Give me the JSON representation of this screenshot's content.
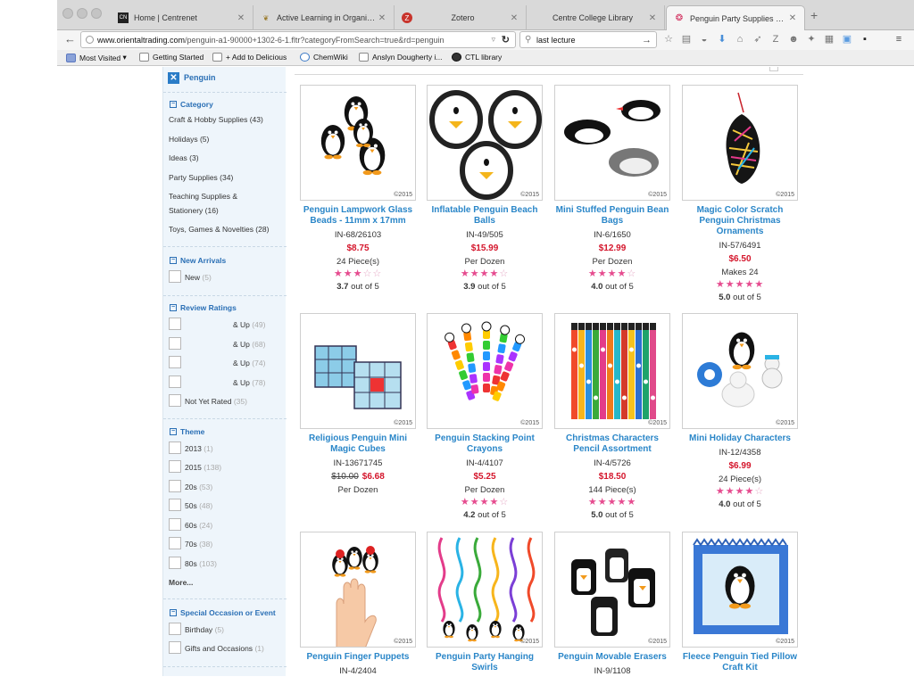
{
  "browser": {
    "tabs": [
      {
        "title": "Home | Centrenet",
        "favicon": "CN"
      },
      {
        "title": "Active Learning in Organic ...",
        "favicon": "leaf"
      },
      {
        "title": "Zotero",
        "favicon": "Z"
      },
      {
        "title": "Centre College Library",
        "favicon": ""
      },
      {
        "title": "Penguin Party Supplies & D...",
        "favicon": "swirl"
      }
    ],
    "url_host": "www.orientaltrading.com",
    "url_path": "/penguin-a1-90000+1302-6-1.fltr?categoryFromSearch=true&rd=penguin",
    "search_value": "last lecture",
    "bookmarks": [
      "Most Visited",
      "Getting Started",
      "+ Add to Delicious",
      "ChemWiki",
      "Anslyn Dougherty i...",
      "CTL library"
    ]
  },
  "sidebar": {
    "filter_tag": "Penguin",
    "category_title": "Category",
    "categories": [
      {
        "label": "Craft & Hobby Supplies (43)"
      },
      {
        "label": "Holidays (5)"
      },
      {
        "label": "Ideas (3)"
      },
      {
        "label": "Party Supplies (34)"
      },
      {
        "label": "Teaching Supplies &"
      },
      {
        "label": "Stationery (16)"
      },
      {
        "label": "Toys, Games & Novelties (28)"
      }
    ],
    "new_arrivals_title": "New Arrivals",
    "new_item": {
      "label": "New",
      "count": "(5)"
    },
    "review_title": "Review Ratings",
    "review_items": [
      {
        "label": "& Up",
        "count": "(49)"
      },
      {
        "label": "& Up",
        "count": "(68)"
      },
      {
        "label": "& Up",
        "count": "(74)"
      },
      {
        "label": "& Up",
        "count": "(78)"
      }
    ],
    "not_rated": {
      "label": "Not Yet Rated",
      "count": "(35)"
    },
    "theme_title": "Theme",
    "theme_items": [
      {
        "label": "2013",
        "count": "(1)"
      },
      {
        "label": "2015",
        "count": "(138)"
      },
      {
        "label": "20s",
        "count": "(53)"
      },
      {
        "label": "50s",
        "count": "(48)"
      },
      {
        "label": "60s",
        "count": "(24)"
      },
      {
        "label": "70s",
        "count": "(38)"
      },
      {
        "label": "80s",
        "count": "(103)"
      }
    ],
    "more_label": "More...",
    "occasion_title": "Special Occasion or Event",
    "occasion_items": [
      {
        "label": "Birthday",
        "count": "(5)"
      },
      {
        "label": "Gifts and Occasions",
        "count": "(1)"
      }
    ]
  },
  "products": [
    {
      "name": "Penguin Lampwork Glass Beads - 11mm x 17mm",
      "sku": "IN-68/26103",
      "price": "$8.75",
      "old_price": "",
      "unit": "24 Piece(s)",
      "stars": 3.7,
      "rating": "3.7",
      "out_of": "out of 5",
      "copyright": "©2015",
      "image": "penguin-beads"
    },
    {
      "name": "Inflatable Penguin Beach Balls",
      "sku": "IN-49/505",
      "price": "$15.99",
      "old_price": "",
      "unit": "Per Dozen",
      "stars": 3.9,
      "rating": "3.9",
      "out_of": "out of 5",
      "copyright": "©2015",
      "image": "penguin-balls"
    },
    {
      "name": "Mini Stuffed Penguin Bean Bags",
      "sku": "IN-6/1650",
      "price": "$12.99",
      "old_price": "",
      "unit": "Per Dozen",
      "stars": 4.0,
      "rating": "4.0",
      "out_of": "out of 5",
      "copyright": "©2015",
      "image": "penguin-beanbags"
    },
    {
      "name": "Magic Color Scratch Penguin Christmas Ornaments",
      "sku": "IN-57/6491",
      "price": "$6.50",
      "old_price": "",
      "unit": "Makes 24",
      "stars": 5.0,
      "rating": "5.0",
      "out_of": "out of 5",
      "copyright": "©2015",
      "image": "penguin-ornament"
    },
    {
      "name": "Religious Penguin Mini Magic Cubes",
      "sku": "IN-13671745",
      "price": "$6.68",
      "old_price": "$10.00",
      "unit": "Per Dozen",
      "stars": 0,
      "rating": "",
      "out_of": "",
      "copyright": "©2015",
      "image": "magic-cubes"
    },
    {
      "name": "Penguin Stacking Point Crayons",
      "sku": "IN-4/4107",
      "price": "$5.25",
      "old_price": "",
      "unit": "Per Dozen",
      "stars": 4.2,
      "rating": "4.2",
      "out_of": "out of 5",
      "copyright": "©2015",
      "image": "stacking-crayons"
    },
    {
      "name": "Christmas Characters Pencil Assortment",
      "sku": "IN-4/5726",
      "price": "$18.50",
      "old_price": "",
      "unit": "144 Piece(s)",
      "stars": 5.0,
      "rating": "5.0",
      "out_of": "out of 5",
      "copyright": "©2015",
      "image": "pencils"
    },
    {
      "name": "Mini Holiday Characters",
      "sku": "IN-12/4358",
      "price": "$6.99",
      "old_price": "",
      "unit": "24 Piece(s)",
      "stars": 4.0,
      "rating": "4.0",
      "out_of": "out of 5",
      "copyright": "©2015",
      "image": "holiday-characters"
    },
    {
      "name": "Penguin Finger Puppets",
      "sku": "IN-4/2404",
      "price": "",
      "old_price": "",
      "unit": "",
      "stars": 0,
      "rating": "",
      "out_of": "",
      "copyright": "©2015",
      "image": "finger-puppets"
    },
    {
      "name": "Penguin Party Hanging Swirls",
      "sku": "",
      "price": "",
      "old_price": "",
      "unit": "",
      "stars": 0,
      "rating": "",
      "out_of": "",
      "copyright": "©2015",
      "image": "hanging-swirls"
    },
    {
      "name": "Penguin Movable Erasers",
      "sku": "IN-9/1108",
      "price": "",
      "old_price": "",
      "unit": "",
      "stars": 0,
      "rating": "",
      "out_of": "",
      "copyright": "©2015",
      "image": "penguin-erasers"
    },
    {
      "name": "Fleece Penguin Tied Pillow Craft Kit",
      "sku": "",
      "price": "",
      "old_price": "",
      "unit": "",
      "stars": 0,
      "rating": "",
      "out_of": "",
      "copyright": "©2015",
      "image": "pillow-kit"
    }
  ],
  "colors": {
    "link": "#2a86c8",
    "price": "#d4152b",
    "star": "#e64c8f",
    "sidebar_bg": "#eef5fb"
  }
}
